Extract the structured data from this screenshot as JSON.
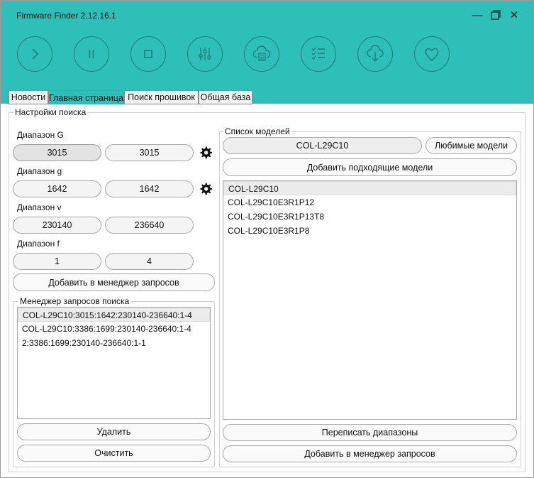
{
  "window": {
    "title": "Firmware Finder 2.12.16.1"
  },
  "toolbar": {
    "buttons": [
      {
        "icon": "play-icon"
      },
      {
        "icon": "pause-icon"
      },
      {
        "icon": "stop-icon"
      },
      {
        "icon": "equalizer-icon"
      },
      {
        "icon": "cloud-document-icon"
      },
      {
        "icon": "checklist-icon"
      },
      {
        "icon": "cloud-download-icon"
      },
      {
        "icon": "heart-icon"
      }
    ]
  },
  "tabs": [
    {
      "label": "Новости"
    },
    {
      "label": "Главная страница",
      "active": true
    },
    {
      "label": "Поиск прошивок"
    },
    {
      "label": "Общая база"
    }
  ],
  "search_settings": {
    "title": "Настройки поиска",
    "range_G": {
      "label": "Диапазон G",
      "from": "3015",
      "to": "3015"
    },
    "range_g": {
      "label": "Диапазон g",
      "from": "1642",
      "to": "1642"
    },
    "range_v": {
      "label": "Диапазон v",
      "from": "230140",
      "to": "236640"
    },
    "range_f": {
      "label": "Диапазон f",
      "from": "1",
      "to": "4"
    },
    "add_to_manager_label": "Добавить в менеджер запросов"
  },
  "request_manager": {
    "title": "Менеджер запросов поиска",
    "items": [
      "COL-L29C10:3015:1642:230140-236640:1-4",
      "COL-L29C10:3386:1699:230140-236640:1-4",
      "2:3386:1699:230140-236640:1-1"
    ],
    "delete_label": "Удалить",
    "clear_label": "Очистить"
  },
  "models": {
    "title": "Список моделей",
    "current_model": "COL-L29C10",
    "favorites_label": "Любимые модели",
    "add_matching_label": "Добавить подходящие модели",
    "items": [
      "COL-L29C10",
      "COL-L29C10E3R1P12",
      "COL-L29C10E3R1P13T8",
      "COL-L29C10E3R1P8"
    ],
    "rewrite_ranges_label": "Переписать диапазоны",
    "add_to_manager_label": "Добавить в менеджер запросов"
  },
  "colors": {
    "accent": "#2ebfb8",
    "icon_stroke": "#1d7f7a"
  }
}
